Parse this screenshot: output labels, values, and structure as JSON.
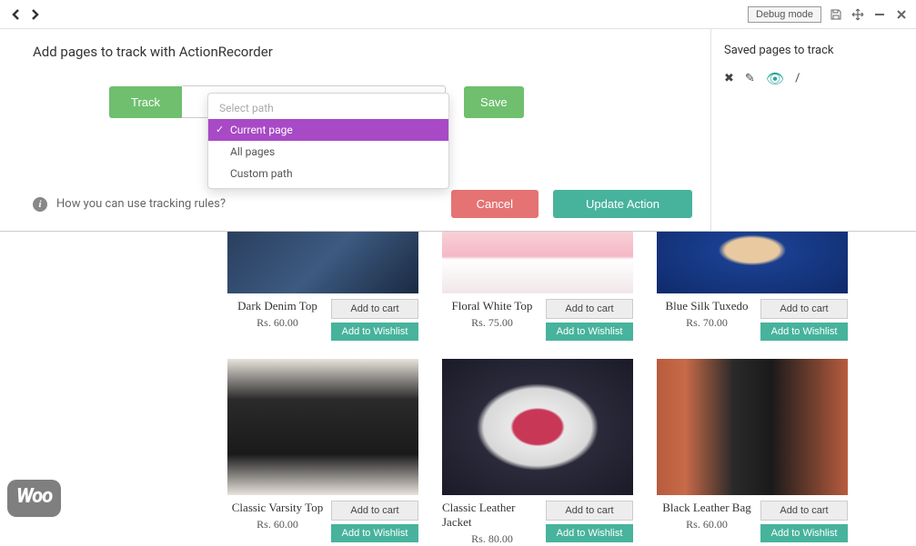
{
  "toolbar": {
    "debug_label": "Debug mode"
  },
  "config": {
    "title": "Add pages to track with ActionRecorder",
    "track_label": "Track",
    "save_label": "Save",
    "cancel_label": "Cancel",
    "update_label": "Update Action",
    "help_text": "How you can use tracking rules?",
    "dropdown": {
      "placeholder": "Select path",
      "options": [
        "Current page",
        "All pages",
        "Custom path"
      ],
      "selected": "Current page"
    }
  },
  "saved": {
    "title": "Saved pages to track",
    "path": "/"
  },
  "products": {
    "add_cart_label": "Add to cart",
    "add_wish_label": "Add to Wishlist",
    "items": [
      {
        "name": "Dark Denim Top",
        "price": "Rs. 60.00",
        "img": "img-denim"
      },
      {
        "name": "Floral White Top",
        "price": "Rs. 75.00",
        "img": "img-floral"
      },
      {
        "name": "Blue Silk Tuxedo",
        "price": "Rs. 70.00",
        "img": "img-tuxedo"
      },
      {
        "name": "Classic Varsity Top",
        "price": "Rs. 60.00",
        "img": "img-varsity"
      },
      {
        "name": "Classic Leather Jacket",
        "price": "Rs. 80.00",
        "img": "img-jacket"
      },
      {
        "name": "Black Leather Bag",
        "price": "Rs. 60.00",
        "img": "img-bag"
      }
    ]
  },
  "logo": "Woo"
}
